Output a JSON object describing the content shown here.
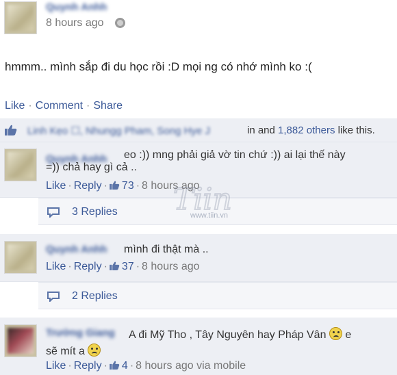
{
  "post": {
    "author": "Quynh Anhh",
    "time": "8 hours ago",
    "text": "hmmm.. mình sắp đi du học rồi :D mọi ng có nhớ mình ko :(",
    "actions": {
      "like": "Like",
      "comment": "Comment",
      "share": "Share",
      "separator": "·"
    }
  },
  "likes": {
    "names": "Linh Kẹo ☐, Nhungg Pham, Song Hye J",
    "rest_prefix": "in and ",
    "others": "1,882 others",
    "rest_suffix": " like this."
  },
  "comments": [
    {
      "author": "Quynh Anhh",
      "text_line1": "eo :)) mng phải giả vờ tin chứ :)) ai lại thế này",
      "text_line2": "=)) chả hay gì cả ..",
      "like": "Like",
      "reply": "Reply",
      "likes_count": "73",
      "time": "8 hours ago",
      "replies": "3 Replies"
    },
    {
      "author": "Quynh Anhh",
      "text_line1": "mình đi thật mà ..",
      "like": "Like",
      "reply": "Reply",
      "likes_count": "37",
      "time": "8 hours ago",
      "replies": "2 Replies"
    },
    {
      "author": "Trường Giang",
      "text_line1": "A đi Mỹ Tho , Tây Nguyên hay Pháp Vân",
      "text_line1_end": "e",
      "text_line2": "sẽ mít a",
      "like": "Like",
      "reply": "Reply",
      "likes_count": "4",
      "time": "8 hours ago via mobile"
    }
  ],
  "watermark": {
    "brand": "Tiin",
    "url": "www.tiin.vn"
  },
  "colors": {
    "link": "#3b5998",
    "panel": "#edeff4",
    "meta": "#777777"
  }
}
